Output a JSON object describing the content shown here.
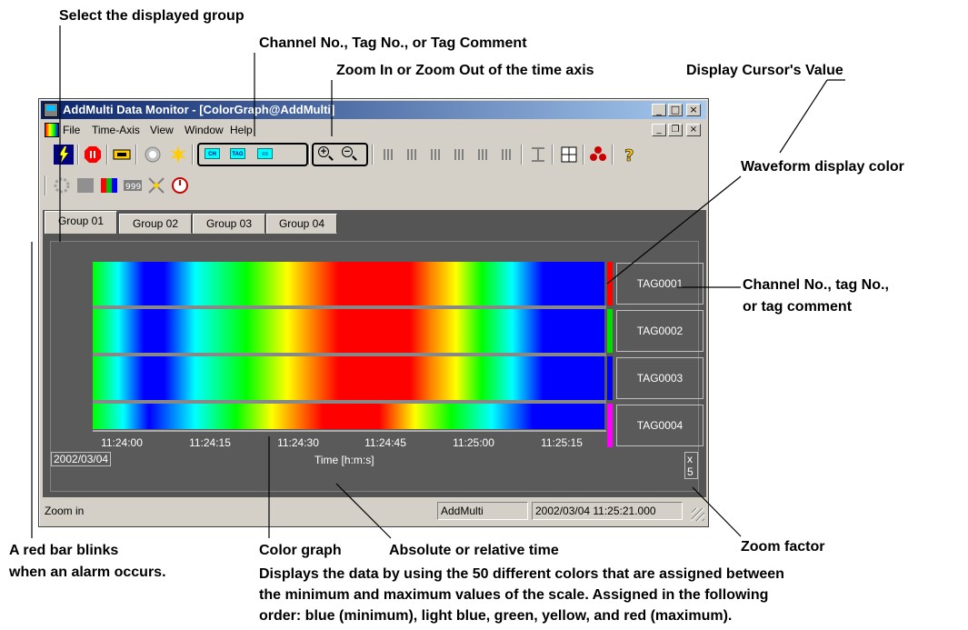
{
  "annotations": {
    "select_group": "Select the displayed group",
    "channel_tag": "Channel No., Tag No., or Tag Comment",
    "zoom_time": "Zoom In or Zoom Out of the time axis",
    "cursor_value": "Display Cursor's Value",
    "waveform_color": "Waveform display color",
    "channel_tag_lower_1": "Channel No., tag No.,",
    "channel_tag_lower_2": "or tag comment",
    "red_bar_1": "A red bar blinks",
    "red_bar_2": "when an alarm occurs.",
    "color_graph": "Color graph",
    "abs_rel_time": "Absolute or relative time",
    "zoom_factor": "Zoom factor",
    "description_lines": [
      "Displays the data by using the 50 different colors that are assigned between",
      "the minimum and maximum values of the scale.  Assigned in the following",
      "order: blue (minimum), light blue, green, yellow, and red (maximum)."
    ]
  },
  "window": {
    "title": "AddMulti Data Monitor - [ColorGraph@AddMulti]",
    "menu": [
      "File",
      "Time-Axis",
      "View",
      "Window",
      "Help"
    ]
  },
  "tabs": [
    "Group 01",
    "Group 02",
    "Group 03",
    "Group 04"
  ],
  "active_tab": "Group 01",
  "tags": [
    {
      "name": "TAG0001",
      "color": "#ff0000"
    },
    {
      "name": "TAG0002",
      "color": "#00dd00"
    },
    {
      "name": "TAG0003",
      "color": "#0000ee"
    },
    {
      "name": "TAG0004",
      "color": "#ff00ff"
    }
  ],
  "time_axis": {
    "ticks": [
      "11:24:00",
      "11:24:15",
      "11:24:30",
      "11:24:45",
      "11:25:00",
      "11:25:15"
    ],
    "date": "2002/03/04",
    "label": "Time [h:m:s]",
    "zoom": "x 5"
  },
  "status": {
    "text": "Zoom in",
    "source": "AddMulti",
    "datetime": "2002/03/04 11:25:21.000"
  },
  "icons": {
    "toolbar1": [
      "flash-icon",
      "stop-icon",
      "record-icon",
      "circle-icon",
      "sparkle-icon",
      "ch-icon",
      "tag-icon",
      "comment-icon",
      "zoom-in-icon",
      "zoom-out-icon",
      "bars1-icon",
      "bars2-icon",
      "bars3-icon",
      "bars4-icon",
      "bars5-icon",
      "bars6-icon",
      "scale-icon",
      "cursor-value-icon",
      "people-icon",
      "help-icon"
    ],
    "toolbar2": [
      "gear-icon",
      "gray-block-icon",
      "color-block-icon",
      "digital-icon",
      "star-icon",
      "clock-icon"
    ]
  }
}
